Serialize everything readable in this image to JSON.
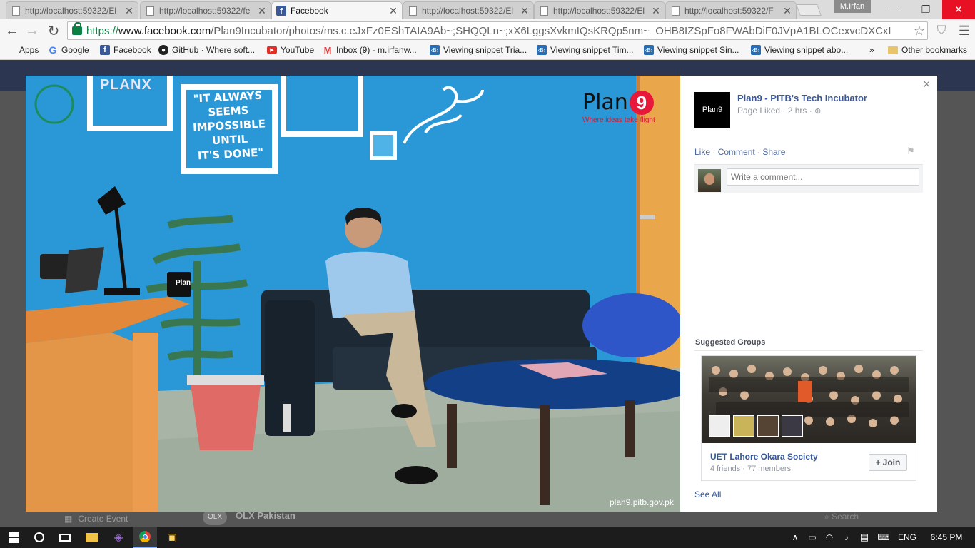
{
  "tabs": [
    {
      "title": "http://localhost:59322/El",
      "active": false
    },
    {
      "title": "http://localhost:59322/fe",
      "active": false
    },
    {
      "title": "Facebook",
      "active": true
    },
    {
      "title": "http://localhost:59322/El",
      "active": false
    },
    {
      "title": "http://localhost:59322/El",
      "active": false
    },
    {
      "title": "http://localhost:59322/F",
      "active": false
    }
  ],
  "window": {
    "user": "M.Irfan"
  },
  "address": {
    "scheme": "https://",
    "host": "www.facebook.com",
    "path": "/Plan9Incubator/photos/ms.c.eJxFz0EShTAIA9Ab~;SHQQLn~;xX6LggsXvkmIQsKRQp5nm~_OHB8IZSpFo8FWAbDiF0JVpA1BLOCexvcDXCxI"
  },
  "bookmarks": [
    {
      "label": "Apps",
      "icon": "apps-grid-icon",
      "color": "#e44"
    },
    {
      "label": "Google",
      "icon": "google-icon",
      "color": "#4285f4"
    },
    {
      "label": "Facebook",
      "icon": "facebook-icon",
      "color": "#3b5998"
    },
    {
      "label": "GitHub · Where soft...",
      "icon": "github-icon",
      "color": "#222"
    },
    {
      "label": "YouTube",
      "icon": "youtube-icon",
      "color": "#e52d27"
    },
    {
      "label": "Inbox (9) - m.irfanw...",
      "icon": "gmail-icon",
      "color": "#d44"
    },
    {
      "label": "Viewing snippet Tria...",
      "icon": "bootply-icon",
      "color": "#2a6db0"
    },
    {
      "label": "Viewing snippet Tim...",
      "icon": "bootply-icon",
      "color": "#2a6db0"
    },
    {
      "label": "Viewing snippet Sin...",
      "icon": "bootply-icon",
      "color": "#2a6db0"
    },
    {
      "label": "Viewing snippet abo...",
      "icon": "bootply-icon",
      "color": "#2a6db0"
    }
  ],
  "bookmarks_overflow": "»",
  "other_bookmarks": "Other bookmarks",
  "photo": {
    "quote": "\"IT ALWAYS SEEMS IMPOSSIBLE UNTIL IT'S DONE\"",
    "quote_lines": [
      "\"IT ALWAYS",
      "SEEMS",
      "IMPOSSIBLE",
      "UNTIL",
      "IT'S DONE\""
    ],
    "brand": "Plan",
    "brand_num": "9",
    "brand_tagline": "Where ideas take flight",
    "planx": "PLANX",
    "mug": "Plan",
    "watermark": "plan9.pitb.gov.pk"
  },
  "post": {
    "page_name": "Plan9 - PITB's Tech Incubator",
    "avatar_text": "Plan9",
    "meta": "Page Liked · 2 hrs · ",
    "actions": [
      "Like",
      "Comment",
      "Share"
    ],
    "comment_placeholder": "Write a comment...",
    "close": "×"
  },
  "suggested": {
    "heading": "Suggested Groups",
    "group_name": "UET Lahore Okara Society",
    "group_meta": "4 friends · 77 members",
    "join_label": "Join",
    "see_all": "See All"
  },
  "taskbar": {
    "lang": "ENG",
    "time": "6:45 PM"
  },
  "behind": {
    "create_event": "Create Event",
    "olx": "OLX Pakistan",
    "search": "Search"
  }
}
